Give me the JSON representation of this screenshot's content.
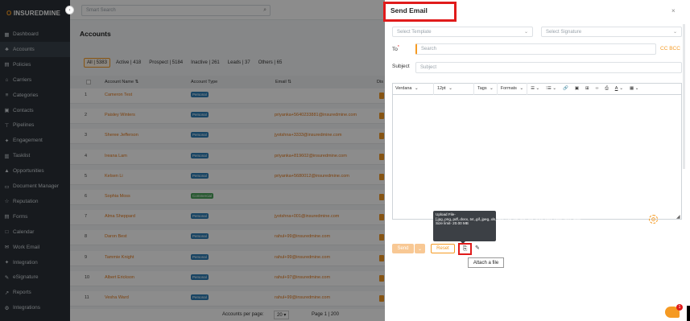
{
  "app": {
    "logo_prefix": "O",
    "logo_text": "INSUREDMINE"
  },
  "sidebar": {
    "items": [
      {
        "label": "Dashboard",
        "icon": "▦"
      },
      {
        "label": "Accounts",
        "icon": "♣"
      },
      {
        "label": "Policies",
        "icon": "▤"
      },
      {
        "label": "Carriers",
        "icon": "⌂"
      },
      {
        "label": "Categories",
        "icon": "≡"
      },
      {
        "label": "Contacts",
        "icon": "▣"
      },
      {
        "label": "Pipelines",
        "icon": "⊤"
      },
      {
        "label": "Engagement",
        "icon": "✦"
      },
      {
        "label": "Tasklist",
        "icon": "▥"
      },
      {
        "label": "Opportunities",
        "icon": "▲"
      },
      {
        "label": "Document Manager",
        "icon": "▭"
      },
      {
        "label": "Reputation",
        "icon": "☆"
      },
      {
        "label": "Forms",
        "icon": "▤"
      },
      {
        "label": "Calendar",
        "icon": "□"
      },
      {
        "label": "Work Email",
        "icon": "✉"
      },
      {
        "label": "Integration",
        "icon": "✦"
      },
      {
        "label": "eSignature",
        "icon": "✎"
      },
      {
        "label": "Reports",
        "icon": "↗"
      },
      {
        "label": "Integrations",
        "icon": "⚙"
      }
    ]
  },
  "header": {
    "search_placeholder": "Smart Search"
  },
  "main": {
    "title": "Accounts",
    "filters": [
      {
        "label": "All",
        "count": "5383"
      },
      {
        "label": "Active",
        "count": "418"
      },
      {
        "label": "Prospect",
        "count": "5184"
      },
      {
        "label": "Inactive",
        "count": "261"
      },
      {
        "label": "Leads",
        "count": "37"
      },
      {
        "label": "Others",
        "count": "65"
      }
    ],
    "columns": {
      "name": "Account Name ⇅",
      "type": "Account Type",
      "email": "Email ⇅",
      "extra": "Dis"
    },
    "rows": [
      {
        "num": "1",
        "name": "Cameron Test",
        "type": "Personal",
        "email": ""
      },
      {
        "num": "2",
        "name": "Paisley Winters",
        "type": "Personal",
        "email": "priyanka+5640233881@insuredmine.com"
      },
      {
        "num": "3",
        "name": "Sheree Jefferson",
        "type": "Personal",
        "email": "jyotshna+3333@insuredmine.com"
      },
      {
        "num": "4",
        "name": "Ireana Lam",
        "type": "Personal",
        "email": "priyanka+819602@insuredmine.com"
      },
      {
        "num": "5",
        "name": "Kelsen Li",
        "type": "Personal",
        "email": "priyanka+5680012@insuredmine.com"
      },
      {
        "num": "6",
        "name": "Sophia Moss",
        "type": "Commercial",
        "email": ""
      },
      {
        "num": "7",
        "name": "Alma Sheppard",
        "type": "Personal",
        "email": "jyotshna+001@insuredmine.com"
      },
      {
        "num": "8",
        "name": "Daron Best",
        "type": "Personal",
        "email": "rahul+99@insuredmine.com"
      },
      {
        "num": "9",
        "name": "Tammie Knight",
        "type": "Personal",
        "email": "rahul+99@insuredmine.com"
      },
      {
        "num": "10",
        "name": "Albert Erickson",
        "type": "Personal",
        "email": "rahul+97@insuredmine.com"
      },
      {
        "num": "11",
        "name": "Vesha Ward",
        "type": "Personal",
        "email": "rahul+99@insuredmine.com"
      }
    ],
    "pager": {
      "label": "Accounts per page:",
      "value": "20",
      "range": "Page 1 | 200"
    }
  },
  "modal": {
    "title": "Send Email",
    "close": "×",
    "template_placeholder": "Select Template",
    "signature_placeholder": "Select Signature",
    "to_label": "To",
    "to_required": "*",
    "to_placeholder": "Search",
    "cc_bcc": "CC  BCC",
    "subject_label": "Subject",
    "subject_placeholder": "Subject",
    "toolbar": {
      "font": "Verdana",
      "size": "12pt",
      "tags": "Tags",
      "formats": "Formats"
    },
    "send": "Send",
    "reset": "Reset",
    "upload_tooltip": "Upload File-[.jpg,.png,.pdf,.docx,.txt,.gif,.jpeg,.xls,.xlsx,.csv,.zip,.doc,.ppt,.docs,.pptx,.ppsx,.mp3,.wav] Size limit- 20.00 MB",
    "attach_tooltip": "Attach a file",
    "chat_badge": "1"
  },
  "colors": {
    "accent": "#f59a23",
    "sidebar": "#2a3137",
    "highlight": "#e01b1b"
  }
}
